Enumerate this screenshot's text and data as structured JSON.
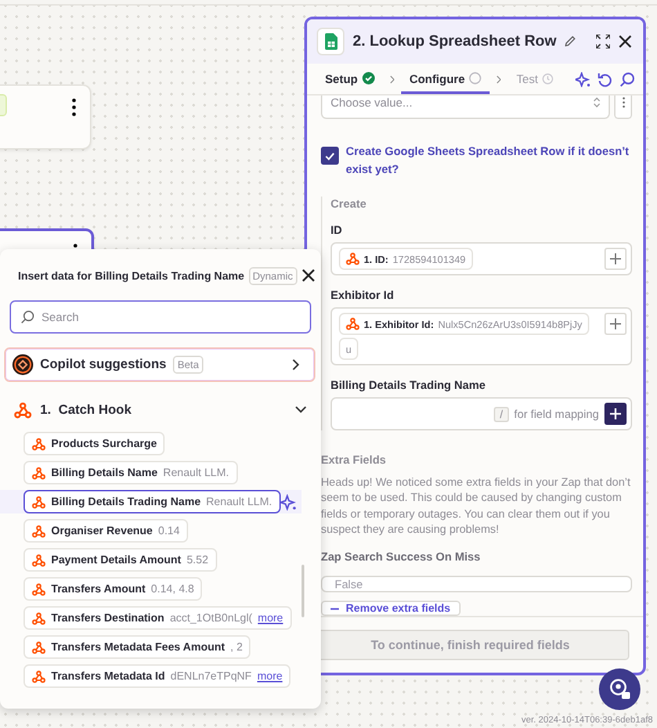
{
  "panel": {
    "step_title": "2. Lookup Spreadsheet Row",
    "tabs": [
      {
        "label": "Setup",
        "complete": true,
        "disabled": false,
        "selected": false
      },
      {
        "label": "Configure",
        "complete": false,
        "disabled": false,
        "selected": true
      },
      {
        "label": "Test",
        "complete": false,
        "disabled": true,
        "selected": false
      }
    ],
    "select": {
      "placeholder": "Choose value..."
    },
    "create_checkbox": {
      "label": "Create Google Sheets Spreadsheet Row if it doesn’t exist yet?",
      "checked": true
    },
    "create_section": {
      "title": "Create",
      "fields": [
        {
          "kind": "mapped",
          "label": "ID",
          "pill": {
            "name": "1. ID:",
            "value": "1728594101349"
          }
        },
        {
          "kind": "mapped",
          "label": "Exhibitor Id",
          "pill": {
            "name": "1. Exhibitor Id:",
            "value": "Nulx5Cn26zArU3s0I5914b8PjJy",
            "overflow": "u"
          }
        },
        {
          "kind": "empty",
          "label": "Billing Details Trading Name",
          "key_hint": "/",
          "hint": "for field mapping"
        }
      ]
    },
    "extra_fields": {
      "title": "Extra Fields",
      "message": "Heads up! We noticed some extra fields in your Zap that don’t seem to be used. This could be caused by changing custom fields or temporary outages. You can clear them out if you suspect they are causing problems!",
      "field_label": "Zap Search Success On Miss",
      "field_placeholder": "False",
      "remove_button": "Remove extra fields"
    },
    "continue_button": {
      "label": "To continue, finish required fields",
      "disabled": true
    }
  },
  "version": "ver. 2024-10-14T06:39-6deb1af8",
  "popover": {
    "title": "Insert data for Billing Details Trading Name",
    "badge": "Dynamic",
    "search": {
      "placeholder": "Search"
    },
    "copilot": {
      "label": "Copilot suggestions",
      "badge": "Beta"
    },
    "group": {
      "number": "1.",
      "title": "Catch Hook",
      "expanded": true,
      "items": [
        {
          "name": "Products Surcharge",
          "selected": false
        },
        {
          "name": "Billing Details Name",
          "value": "Renault LLM.",
          "selected": false
        },
        {
          "name": "Billing Details Trading Name",
          "value": "Renault LLM.",
          "selected": true
        },
        {
          "name": "Organiser Revenue",
          "value": "0.14",
          "selected": false
        },
        {
          "name": "Payment Details Amount",
          "value": "5.52",
          "selected": false
        },
        {
          "name": "Transfers Amount",
          "value": "0.14, 4.8",
          "selected": false
        },
        {
          "name": "Transfers Destination",
          "value": "acct_1OtB0nLgl(",
          "more": "more",
          "selected": false
        },
        {
          "name": "Transfers Metadata Fees Amount",
          "value": ", 2",
          "selected": false
        },
        {
          "name": "Transfers Metadata Id",
          "value": "dENLn7eTPqNF",
          "more": "more",
          "selected": false
        }
      ]
    }
  }
}
